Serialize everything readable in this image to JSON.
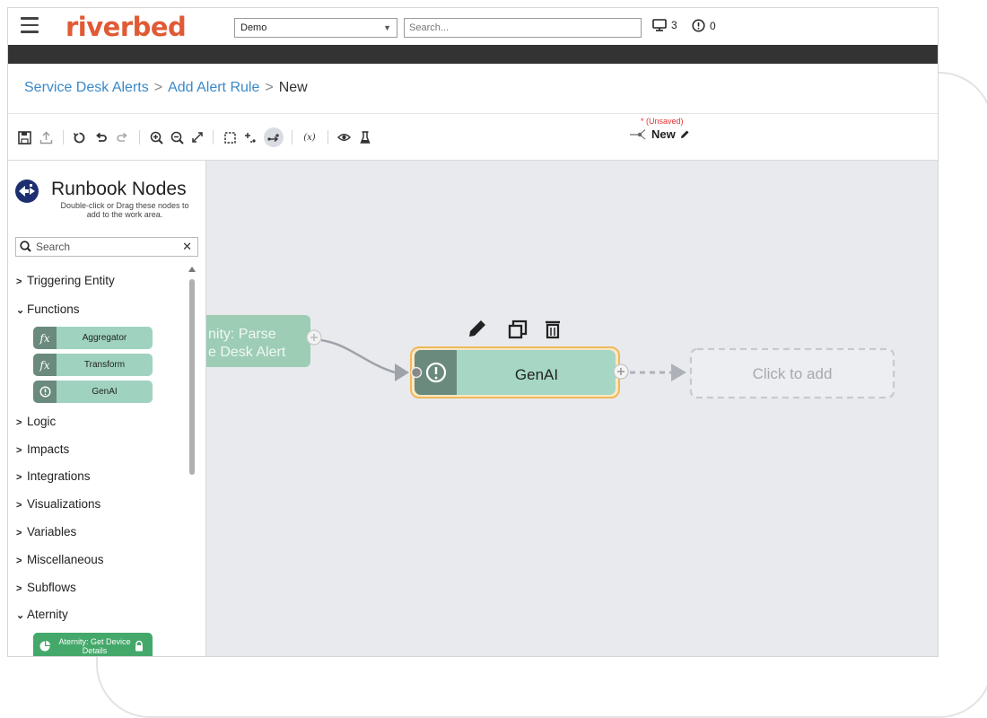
{
  "app": {
    "brand": "riverbed",
    "context_select": "Demo",
    "search_placeholder": "Search...",
    "monitor_count": "3",
    "alert_count": "0"
  },
  "breadcrumb": {
    "items": [
      "Service Desk Alerts",
      "Add Alert Rule",
      "New"
    ],
    "separator": ">"
  },
  "toolbar": {
    "status": "* (Unsaved)",
    "doc_name": "New",
    "variables_label": "(x)"
  },
  "sidebar": {
    "title": "Runbook Nodes",
    "description": "Double-click or Drag these nodes to add to the work area.",
    "search_placeholder": "Search",
    "categories": [
      {
        "label": "Triggering Entity"
      },
      {
        "label": "Functions"
      },
      {
        "label": "Logic"
      },
      {
        "label": "Impacts"
      },
      {
        "label": "Integrations"
      },
      {
        "label": "Visualizations"
      },
      {
        "label": "Variables"
      },
      {
        "label": "Miscellaneous"
      },
      {
        "label": "Subflows"
      },
      {
        "label": "Aternity"
      }
    ],
    "function_nodes": [
      {
        "label": "Aggregator",
        "icon": "fx-icon"
      },
      {
        "label": "Transform",
        "icon": "fx-icon"
      },
      {
        "label": "GenAI",
        "icon": "alert-circle-icon"
      }
    ],
    "aternity_node": {
      "label": "Aternity: Get Device Details",
      "icon": "pie-chart-icon"
    }
  },
  "canvas": {
    "prev_node_label_line1": "nity: Parse",
    "prev_node_label_line2": "e Desk Alert",
    "active_node_label": "GenAI",
    "placeholder_label": "Click to add"
  },
  "colors": {
    "brand": "#e05a35",
    "link": "#3a89c9",
    "node_fill": "#a6d7c4",
    "node_icon_bg": "#6a8a7e",
    "selection_outline": "#f0b95a",
    "unsaved": "#e03030"
  }
}
